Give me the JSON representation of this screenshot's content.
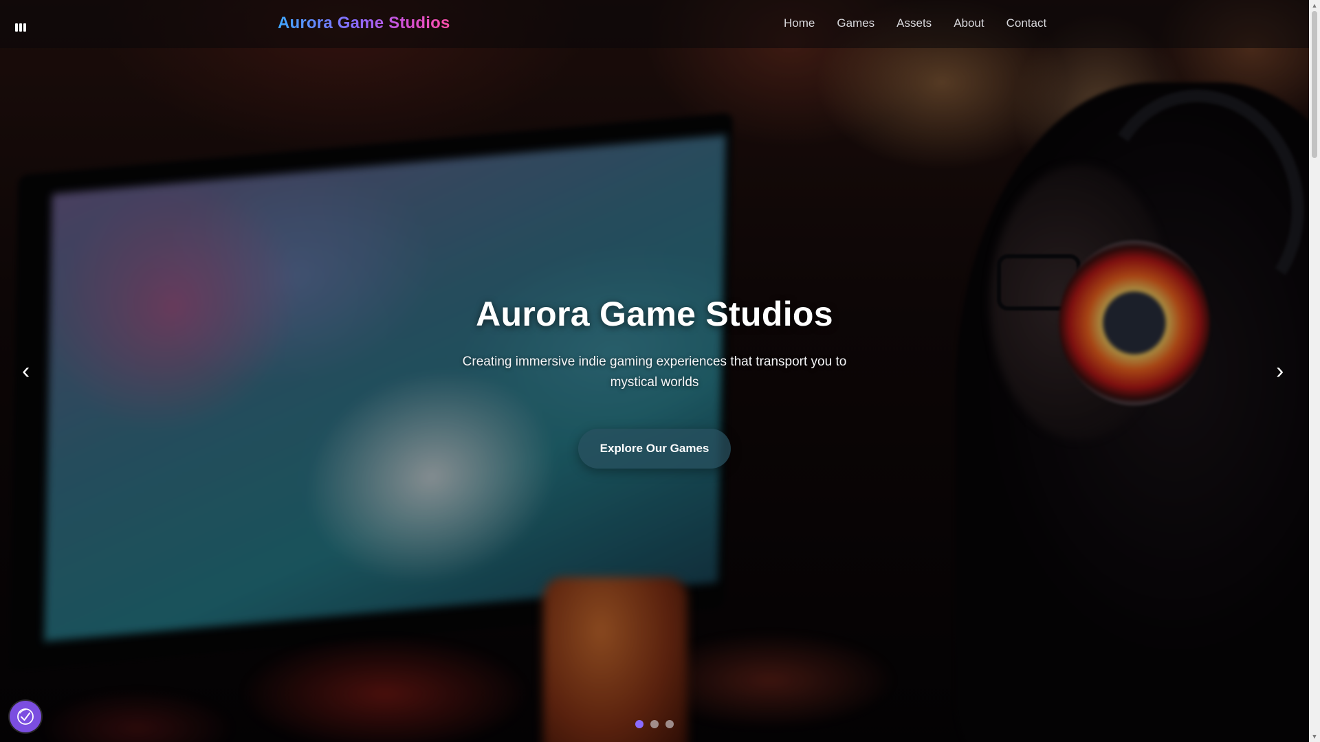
{
  "navbar": {
    "brand": "Aurora Game Studios",
    "links": [
      "Home",
      "Games",
      "Assets",
      "About",
      "Contact"
    ],
    "menu_icon": "bars-icon"
  },
  "hero": {
    "title": "Aurora Game Studios",
    "subtitle": "Creating immersive indie gaming experiences that transport you to mystical worlds",
    "cta_label": "Explore Our Games",
    "background": "blurred photo of a gamer wearing glowing headphones in front of a monitor"
  },
  "carousel": {
    "prev_icon": "chevron-left-icon",
    "next_icon": "chevron-right-icon",
    "prev_glyph": "‹",
    "next_glyph": "›",
    "slide_count": 3,
    "active_index": 0
  },
  "accessibility": {
    "icon": "accessibility-icon"
  },
  "scrollbar": {
    "up_glyph": "▲",
    "down_glyph": "▼"
  },
  "colors": {
    "brand_gradient_start": "#3fa7ff",
    "brand_gradient_end": "#ff4fa8",
    "active_dot": "#8a6bff",
    "accessibility_button": "#7b4ee0",
    "cta_background": "#28505f"
  }
}
